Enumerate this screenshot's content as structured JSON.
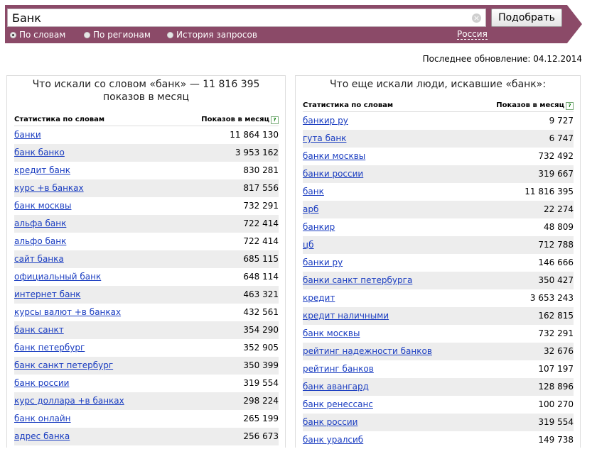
{
  "search": {
    "value": "Банк",
    "submit_label": "Подобрать",
    "clear_glyph": "×",
    "region": "Россия"
  },
  "modes": [
    {
      "label": "По словам",
      "selected": true
    },
    {
      "label": "По регионам",
      "selected": false
    },
    {
      "label": "История запросов",
      "selected": false
    }
  ],
  "last_update": "Последнее обновление: 04.12.2014",
  "left": {
    "title": "Что искали со словом «банк» — 11 816 395 показов в месяц",
    "col_phrase": "Статистика по словам",
    "col_shows": "Показов в месяц",
    "help": "?",
    "rows": [
      {
        "phrase": "банки",
        "shows": "11 864 130"
      },
      {
        "phrase": "банк банко",
        "shows": "3 953 162"
      },
      {
        "phrase": "кредит банк",
        "shows": "830 281"
      },
      {
        "phrase": "курс +в банках",
        "shows": "817 556"
      },
      {
        "phrase": "банк москвы",
        "shows": "732 291"
      },
      {
        "phrase": "альфа банк",
        "shows": "722 414"
      },
      {
        "phrase": "альфо банк",
        "shows": "722 414"
      },
      {
        "phrase": "сайт банка",
        "shows": "685 115"
      },
      {
        "phrase": "официальный банк",
        "shows": "648 114"
      },
      {
        "phrase": "интернет банк",
        "shows": "463 321"
      },
      {
        "phrase": "курсы валют +в банках",
        "shows": "432 561"
      },
      {
        "phrase": "банк санкт",
        "shows": "354 290"
      },
      {
        "phrase": "банк петербург",
        "shows": "352 905"
      },
      {
        "phrase": "банк санкт петербург",
        "shows": "350 399"
      },
      {
        "phrase": "банк россии",
        "shows": "319 554"
      },
      {
        "phrase": "курс доллара +в банках",
        "shows": "298 224"
      },
      {
        "phrase": "банк онлайн",
        "shows": "265 199"
      },
      {
        "phrase": "адрес банка",
        "shows": "256 673"
      }
    ]
  },
  "right": {
    "title": "Что еще искали люди, искавшие «банк»:",
    "col_phrase": "Статистика по словам",
    "col_shows": "Показов в месяц",
    "help": "?",
    "rows": [
      {
        "phrase": "банкир ру",
        "shows": "9 727"
      },
      {
        "phrase": "гута банк",
        "shows": "6 747"
      },
      {
        "phrase": "банки москвы",
        "shows": "732 492"
      },
      {
        "phrase": "банки россии",
        "shows": "319 667"
      },
      {
        "phrase": "банк",
        "shows": "11 816 395"
      },
      {
        "phrase": "арб",
        "shows": "22 274"
      },
      {
        "phrase": "банкир",
        "shows": "48 809"
      },
      {
        "phrase": "цб",
        "shows": "712 788"
      },
      {
        "phrase": "банки ру",
        "shows": "146 666"
      },
      {
        "phrase": "банки санкт петербурга",
        "shows": "350 427"
      },
      {
        "phrase": "кредит",
        "shows": "3 653 243"
      },
      {
        "phrase": "кредит наличными",
        "shows": "162 815"
      },
      {
        "phrase": "банк москвы",
        "shows": "732 291"
      },
      {
        "phrase": "рейтинг надежности банков",
        "shows": "32 676"
      },
      {
        "phrase": "рейтинг банков",
        "shows": "107 197"
      },
      {
        "phrase": "банк авангард",
        "shows": "128 896"
      },
      {
        "phrase": "банк ренессанс",
        "shows": "100 270"
      },
      {
        "phrase": "банк россии",
        "shows": "319 554"
      },
      {
        "phrase": "банк уралсиб",
        "shows": "149 738"
      }
    ]
  }
}
